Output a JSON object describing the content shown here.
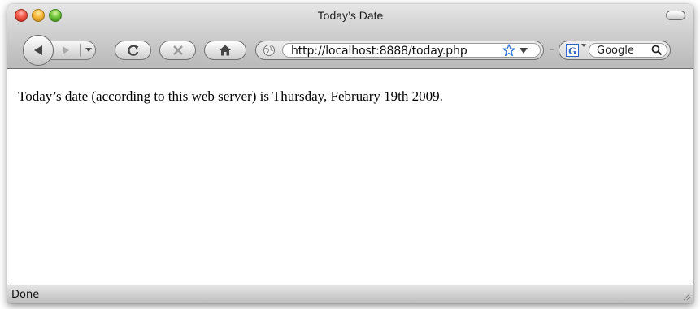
{
  "window": {
    "title": "Today’s Date"
  },
  "toolbar": {
    "back_icon": "back-arrow-icon",
    "forward_icon": "forward-arrow-icon",
    "reload_icon": "reload-icon",
    "stop_icon": "stop-icon",
    "home_icon": "home-icon",
    "url": "http://localhost:8888/today.php",
    "search_placeholder": "Google",
    "search_engine_glyph": "G"
  },
  "page": {
    "text": "Today’s date (according to this web server) is Thursday, February 19th 2009."
  },
  "status": {
    "text": "Done"
  },
  "colors": {
    "close": "#f25a4a",
    "minimize": "#f7b83a",
    "zoom": "#73c53c",
    "bookmark_star": "#3a78d8",
    "search_engine": "#2f64c8"
  }
}
